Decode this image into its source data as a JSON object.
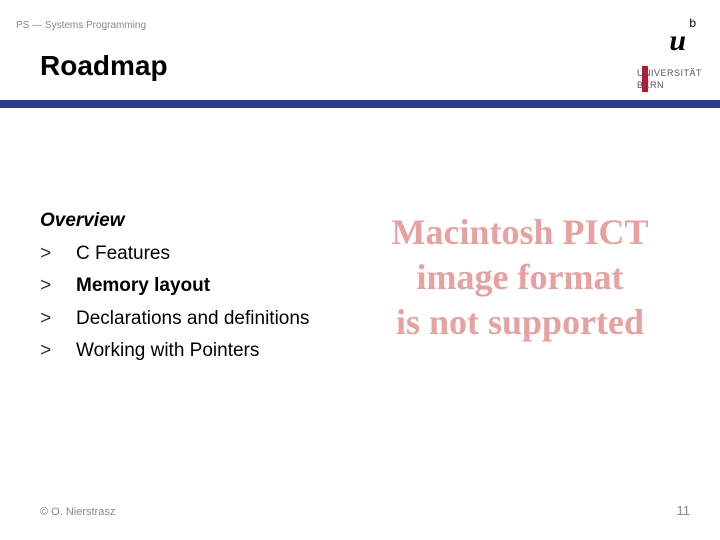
{
  "header": {
    "strip": "PS — Systems Programming",
    "title": "Roadmap"
  },
  "logo": {
    "b": "b",
    "u": "u",
    "line1": "UNIVERSITÄT",
    "line2": "BERN"
  },
  "overview": {
    "label": "Overview",
    "items": [
      {
        "text": "C Features",
        "bold": false
      },
      {
        "text": "Memory layout",
        "bold": true
      },
      {
        "text": "Declarations and definitions",
        "bold": false
      },
      {
        "text": "Working with Pointers",
        "bold": false
      }
    ]
  },
  "watermark": {
    "line1": "Macintosh PICT",
    "line2": "image format",
    "line3": "is not supported"
  },
  "footer": {
    "copyright": "© O. Nierstrasz",
    "page": "11"
  },
  "marker": ">"
}
